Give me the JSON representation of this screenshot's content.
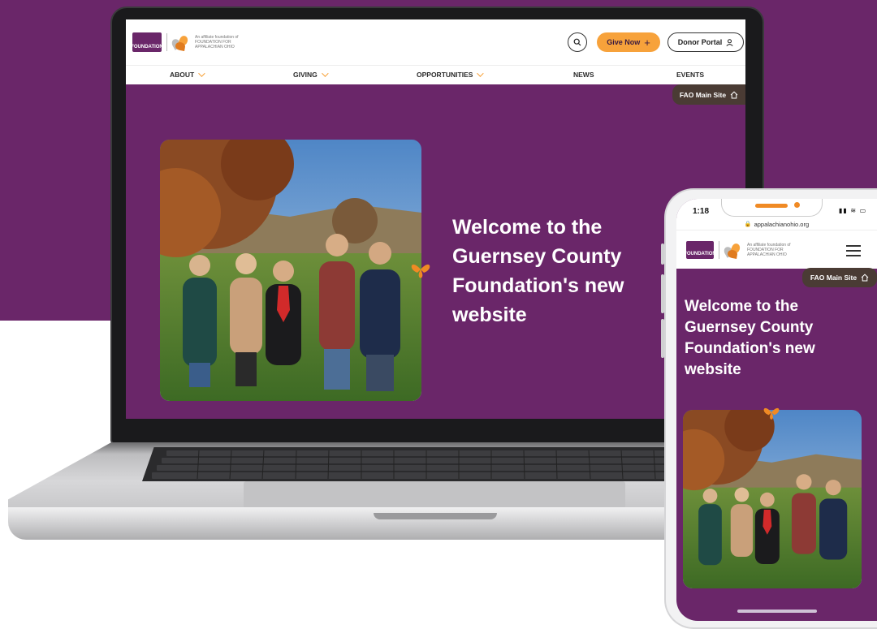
{
  "site": {
    "logo": {
      "gcf_text": "FOUNDATION",
      "fao_text": "An affiliate foundation of FOUNDATION FOR APPALACHIAN OHIO"
    },
    "header": {
      "give_label": "Give Now",
      "donor_label": "Donor Portal"
    },
    "nav": [
      "ABOUT",
      "GIVING",
      "OPPORTUNITIES",
      "NEWS",
      "EVENTS"
    ],
    "fao_tab_label": "FAO Main Site",
    "hero_title": "Welcome to the Guernsey County Foundation's new website"
  },
  "phone": {
    "time": "1:18",
    "url": "appalachianohio.org",
    "fao_tab_label": "FAO Main Site",
    "hero_title": "Welcome to the Guernsey County Foundation's new website"
  },
  "colors": {
    "brand_purple": "#6a2669",
    "accent_orange": "#f7a23b",
    "tab_brown": "#4a3b34"
  }
}
